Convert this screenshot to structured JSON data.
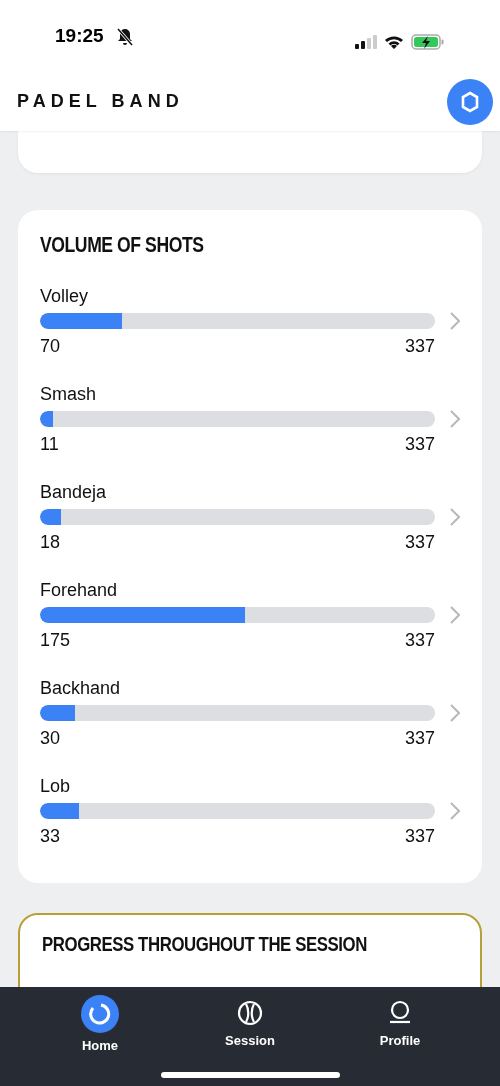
{
  "status_bar": {
    "time": "19:25"
  },
  "header": {
    "logo": "PADEL BAND"
  },
  "volume_card": {
    "title": "VOLUME OF SHOTS",
    "shots": [
      {
        "name": "Volley",
        "value": "70",
        "total": "337",
        "level": 0.208
      },
      {
        "name": "Smash",
        "value": "11",
        "total": "337",
        "level": 0.033
      },
      {
        "name": "Bandeja",
        "value": "18",
        "total": "337",
        "level": 0.053
      },
      {
        "name": "Forehand",
        "value": "175",
        "total": "337",
        "level": 0.519
      },
      {
        "name": "Backhand",
        "value": "30",
        "total": "337",
        "level": 0.089
      },
      {
        "name": "Lob",
        "value": "33",
        "total": "337",
        "level": 0.098
      }
    ]
  },
  "progress_card": {
    "title": "PROGRESS THROUGHOUT THE SESSION"
  },
  "tab_bar": [
    {
      "label": "Home",
      "kind": "home",
      "selected": true
    },
    {
      "label": "Session",
      "kind": "session",
      "selected": false
    },
    {
      "label": "Profile",
      "kind": "profile",
      "selected": false
    }
  ]
}
